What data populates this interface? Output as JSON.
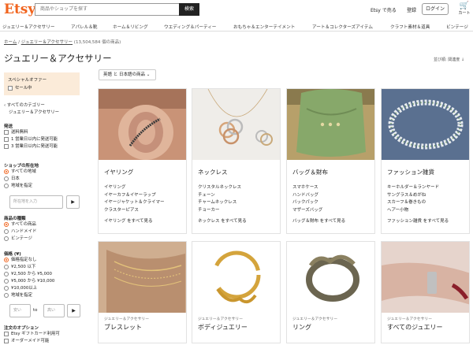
{
  "header": {
    "logo": "Etsy",
    "search_placeholder": "商品やショップを探す",
    "search_button": "検索",
    "sell": "Etsy で売る",
    "register": "登録",
    "login": "ログイン",
    "cart": "カート"
  },
  "nav": [
    "ジュエリー＆アクセサリー",
    "アパレル＆靴",
    "ホーム＆リビング",
    "ウエディング＆パーティー",
    "おもちゃ＆エンターテイメント",
    "アート＆コレクターズアイテム",
    "クラフト素材＆道具",
    "ビンテージ"
  ],
  "breadcrumb": {
    "home": "ホーム",
    "category": "ジュエリー＆アクセサリー",
    "count": "(13,504,584 個の商品)"
  },
  "page_title": "ジュエリー＆アクセサリー",
  "sort": "並び順: 関連度 ↓",
  "filter_chip": "英語 と 日本語の商品 ⌄",
  "sidebar": {
    "special_title": "スペシャルオファー",
    "sale": "セール中",
    "back": "すべてのカテゴリー",
    "current": "ジュエリー＆アクセサリー",
    "shipping_title": "発送",
    "shipping": [
      "送料無料",
      "1 営業日以内に発送可能",
      "3 営業日以内に発送可能"
    ],
    "location_title": "ショップの所在地",
    "location": [
      "すべての地域",
      "日本",
      "地域を指定"
    ],
    "location_placeholder": "所在地を入力",
    "type_title": "商品の種類",
    "type": [
      "すべての商品",
      "ハンドメイド",
      "ビンテージ"
    ],
    "price_title": "価格 (¥)",
    "price": [
      "価格指定なし",
      "¥2,500 以下",
      "¥2,500 から ¥5,000",
      "¥5,000 から ¥10,000",
      "¥10,000以上",
      "地域を指定"
    ],
    "min": "安い",
    "to": "to",
    "max": "高い",
    "order_title": "注文のオプション",
    "order": [
      "Etsy ギフトカード利用可",
      "オーダーメイド可能"
    ]
  },
  "cards": [
    {
      "title": "イヤリング",
      "items": [
        "イヤリング",
        "イヤーカフ＆イヤーラップ",
        "イヤージャケット＆クライマー",
        "クラスターピアス"
      ],
      "see_all": "イヤリング をすべて見る"
    },
    {
      "title": "ネックレス",
      "items": [
        "クリスタルネックレス",
        "チェーン",
        "チャームネックレス",
        "チョーカー"
      ],
      "see_all": "ネックレス をすべて見る"
    },
    {
      "title": "バッグ＆財布",
      "items": [
        "スマホケース",
        "ハンドバッグ",
        "バックパック",
        "マザーズバッグ"
      ],
      "see_all": "バッグ＆財布 をすべて見る"
    },
    {
      "title": "ファッション雑貨",
      "items": [
        "キーホルダー＆ランヤード",
        "サングラス＆めがね",
        "スカーフ＆巻きもの",
        "ヘアー小物"
      ],
      "see_all": "ファッション雑貨 をすべて見る"
    }
  ],
  "cards2": [
    {
      "category": "ジュエリー＆アクセサリー",
      "title": "ブレスレット"
    },
    {
      "category": "ジュエリー＆アクセサリー",
      "title": "ボディジュエリー"
    },
    {
      "category": "ジュエリー＆アクセサリー",
      "title": "リング"
    },
    {
      "category": "ジュエリー＆アクセサリー",
      "title": "すべてのジュエリー"
    }
  ]
}
